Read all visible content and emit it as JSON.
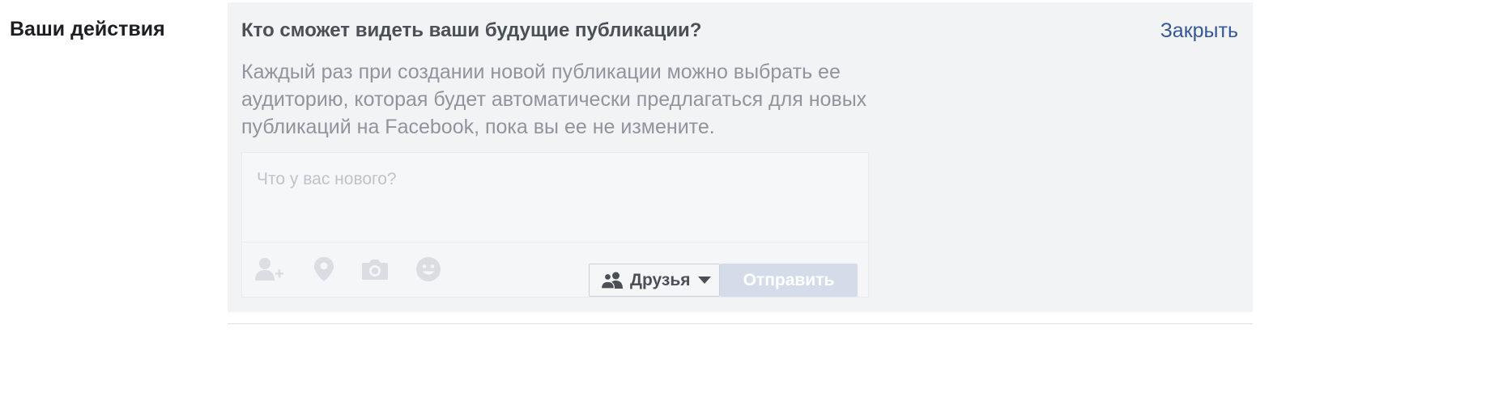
{
  "section": {
    "label": "Ваши действия"
  },
  "panel": {
    "question": "Кто сможет видеть ваши будущие публикации?",
    "close_label": "Закрыть",
    "description": "Каждый раз при создании новой публикации можно выбрать ее аудиторию, которая будет автоматически предлагаться для новых публикаций на Facebook, пока вы ее не измените."
  },
  "composer": {
    "placeholder": "Что у вас нового?",
    "tools": [
      "tag-friends-icon",
      "location-pin-icon",
      "camera-icon",
      "emoji-icon"
    ],
    "audience": {
      "label": "Друзья",
      "icon": "friends-icon"
    },
    "send_label": "Отправить"
  },
  "colors": {
    "panel_bg": "#f2f3f5",
    "link": "#365899",
    "send_disabled": "#d4dce9"
  }
}
